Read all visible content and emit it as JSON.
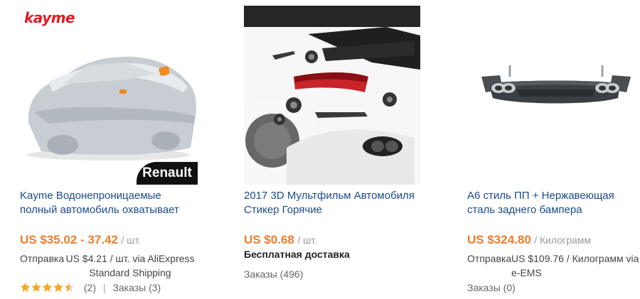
{
  "products": [
    {
      "brand_logo": "kayme",
      "image_badge": "Renault",
      "title": "Kayme Водонепроницаемые полный автомобиль охватывает",
      "price": "US $35.02 - 37.42",
      "unit": "/ шт.",
      "shipping_label": "Отправка",
      "shipping_detail": "US $4.21 / шт. via AliExpress Standard Shipping",
      "rating": 4.5,
      "reviews": "(2)",
      "orders": "Заказы (3)"
    },
    {
      "title": "2017 3D Мультфильм Автомобиля Стикер Горячие",
      "price": "US $0.68",
      "unit": "/ шт.",
      "shipping_free": "Бесплатная доставка",
      "orders": "Заказы (496)"
    },
    {
      "title": "A6 стиль ПП + Нержавеющая сталь заднего бампера",
      "price": "US $324.80",
      "unit": "/ Килограмм",
      "shipping_label": "Отправка",
      "shipping_detail": "US $109.76 / Килограмм via e-EMS",
      "orders": "Заказы (0)"
    }
  ],
  "colors": {
    "price": "#f07c2c",
    "title_link": "#1a4a8a",
    "brand": "#e01b22",
    "star": "#f5a623"
  }
}
